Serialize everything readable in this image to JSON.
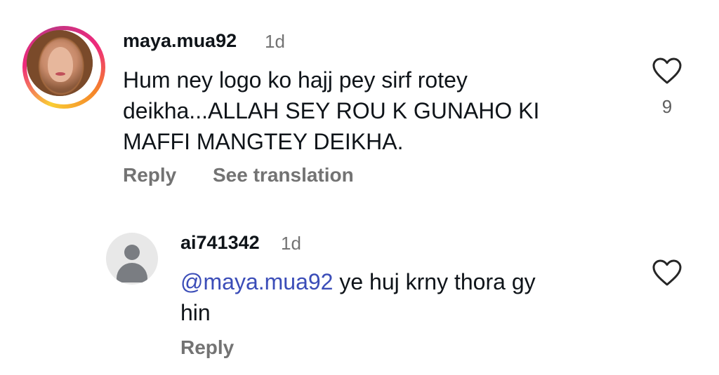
{
  "comments": [
    {
      "username": "maya.mua92",
      "time": "1d",
      "text": "Hum ney logo ko hajj pey sirf rotey deikha...ALLAH SEY ROU K GUNAHO KI MAFFI MANGTEY DEIKHA.",
      "text_lines": [
        "Hum ney logo ko hajj pey sirf rotey",
        "deikha...ALLAH SEY ROU K GUNAHO KI",
        "MAFFI MANGTEY DEIKHA."
      ],
      "likes": "9",
      "reply_label": "Reply",
      "translate_label": "See translation",
      "has_story_ring": true
    },
    {
      "username": "ai741342",
      "time": "1d",
      "mention": "@maya.mua92",
      "text_after_mention": " ye huj krny thora gy",
      "text_line2": "hin",
      "reply_label": "Reply"
    }
  ],
  "icons": {
    "like": "heart-outline-icon",
    "default_avatar": "person-silhouette-icon"
  },
  "colors": {
    "text": "#0f1419",
    "muted": "#737373",
    "mention": "#3b4db8"
  }
}
